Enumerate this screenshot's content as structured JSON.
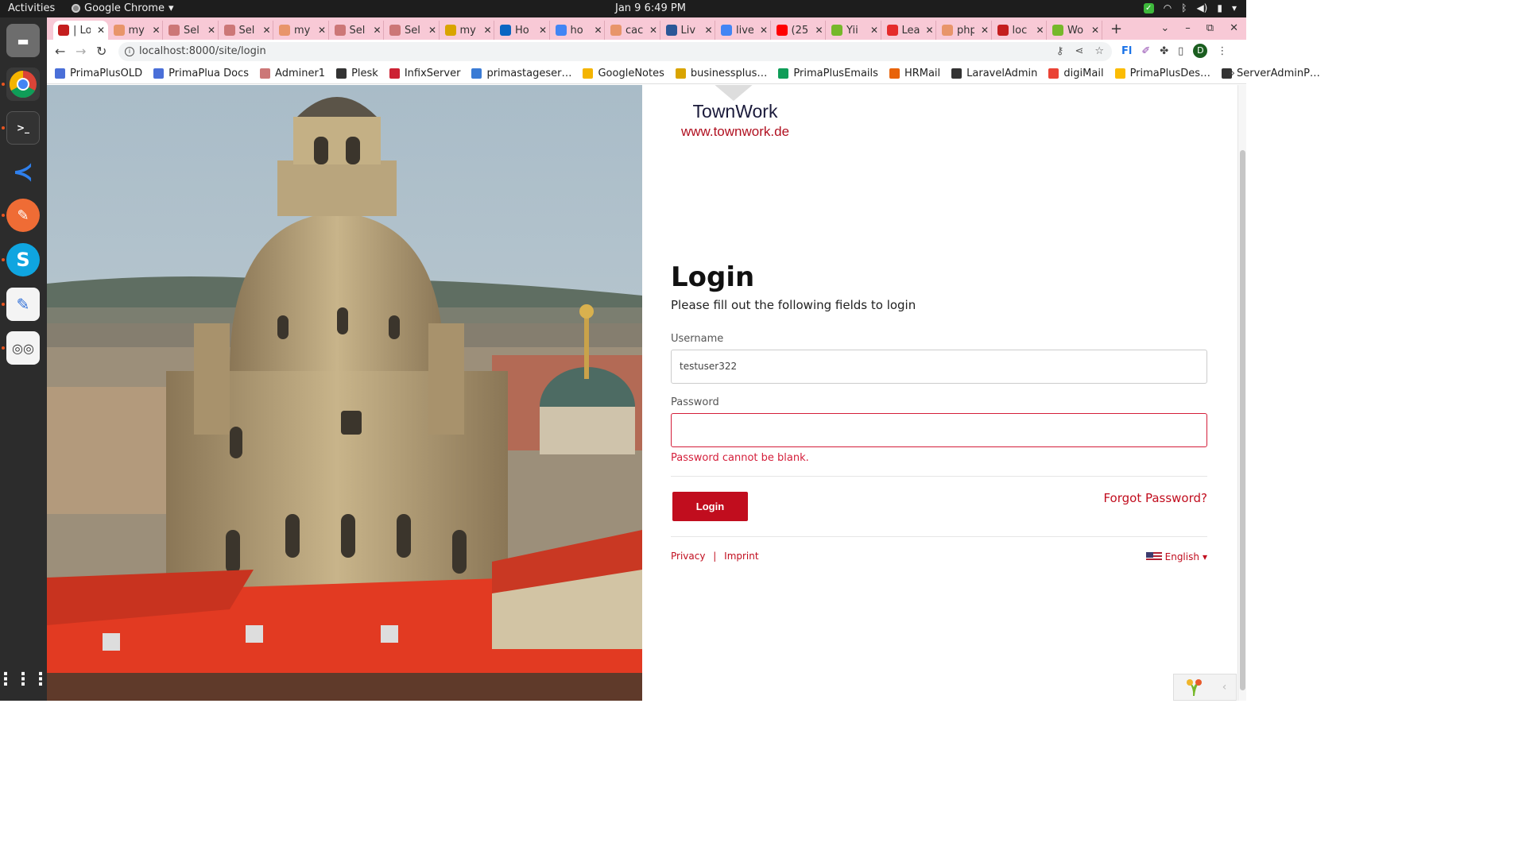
{
  "system": {
    "activities": "Activities",
    "app_name": "Google Chrome",
    "clock": "Jan 9  6:49 PM"
  },
  "tabs": [
    {
      "title": "| Lo",
      "color": "#c41e1e"
    },
    {
      "title": "my",
      "color": "#e8956a"
    },
    {
      "title": "Sel",
      "color": "#c77"
    },
    {
      "title": "Sel",
      "color": "#c77"
    },
    {
      "title": "my",
      "color": "#e8956a"
    },
    {
      "title": "Sel",
      "color": "#c77"
    },
    {
      "title": "Sel",
      "color": "#c77"
    },
    {
      "title": "my",
      "color": "#d9a400"
    },
    {
      "title": "Ho",
      "color": "#0a66c2"
    },
    {
      "title": "ho",
      "color": "#4285f4"
    },
    {
      "title": "cac",
      "color": "#e8956a"
    },
    {
      "title": "Liv",
      "color": "#2b5797"
    },
    {
      "title": "live",
      "color": "#4285f4"
    },
    {
      "title": "(25",
      "color": "#ff0000"
    },
    {
      "title": "Yii",
      "color": "#76b82a"
    },
    {
      "title": "Lea",
      "color": "#e52b2b"
    },
    {
      "title": "php",
      "color": "#e8956a"
    },
    {
      "title": "loc",
      "color": "#c41e1e"
    },
    {
      "title": "Wo",
      "color": "#76b82a"
    }
  ],
  "address": {
    "url": "localhost:8000/site/login"
  },
  "bookmarks": [
    {
      "label": "PrimaPlusOLD",
      "color": "#4a6fd8"
    },
    {
      "label": "PrimaPlua Docs",
      "color": "#4a6fd8"
    },
    {
      "label": "Adminer1",
      "color": "#c77"
    },
    {
      "label": "Plesk",
      "color": "#333"
    },
    {
      "label": "InfixServer",
      "color": "#c23"
    },
    {
      "label": "primastageser…",
      "color": "#3a7bd5"
    },
    {
      "label": "GoogleNotes",
      "color": "#f4b400"
    },
    {
      "label": "businessplus…",
      "color": "#d9a400"
    },
    {
      "label": "PrimaPlusEmails",
      "color": "#0f9d58"
    },
    {
      "label": "HRMail",
      "color": "#e8630a"
    },
    {
      "label": "LaravelAdmin",
      "color": "#333"
    },
    {
      "label": "digiMail",
      "color": "#ea4335"
    },
    {
      "label": "PrimaPlusDes…",
      "color": "#fbbc04"
    },
    {
      "label": "ServerAdminP…",
      "color": "#333"
    }
  ],
  "brand": {
    "name": "TownWork",
    "url": "www.townwork.de"
  },
  "login": {
    "title": "Login",
    "subtitle": "Please fill out the following fields to login",
    "username_label": "Username",
    "username_value": "testuser322",
    "password_label": "Password",
    "password_value": "",
    "password_error": "Password cannot be blank.",
    "submit_label": "Login",
    "forgot_label": "Forgot Password?"
  },
  "footer": {
    "privacy": "Privacy",
    "separator": "|",
    "imprint": "Imprint",
    "language": "English"
  },
  "colors": {
    "accent": "#c10d1e",
    "tabstrip": "#f8c9d6",
    "error": "#d41e3a"
  }
}
